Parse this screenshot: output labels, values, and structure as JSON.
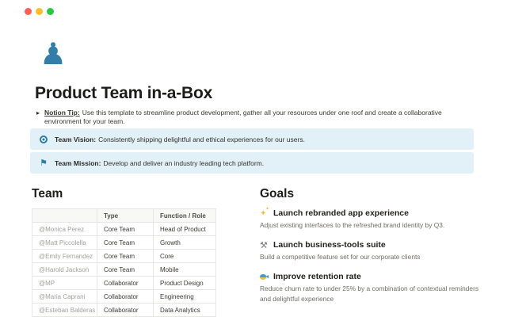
{
  "colors": {
    "accent_blue": "#337ea9",
    "callout_bg": "#e2f0f7",
    "traffic_red": "#ff5f57",
    "traffic_yellow": "#febc2e",
    "traffic_green": "#28c840"
  },
  "page": {
    "icon_glyph": "♟",
    "title": "Product Team in-a-Box",
    "tip": {
      "toggle_glyph": "▸",
      "label": "Notion Tip:",
      "text": "Use this template to streamline product development, gather all your resources under one roof and create a collaborative environment for your team."
    }
  },
  "callouts": [
    {
      "icon": "target-icon",
      "label": "Team Vision:",
      "text": "Consistently shipping delightful and ethical experiences for our users."
    },
    {
      "icon": "flag-icon",
      "glyph": "⚑",
      "label": "Team Mission:",
      "text": "Develop and deliver an industry leading tech platform."
    }
  ],
  "team": {
    "heading": "Team",
    "table": {
      "headers": [
        "",
        "Type",
        "Function / Role"
      ],
      "rows": [
        {
          "member": "@Monica Perez",
          "type": "Core Team",
          "role": "Head of Product"
        },
        {
          "member": "@Matt Piccolella",
          "type": "Core Team",
          "role": "Growth"
        },
        {
          "member": "@Emily Fernandez",
          "type": "Core Team",
          "role": "Core"
        },
        {
          "member": "@Harold Jackson",
          "type": "Core Team",
          "role": "Mobile"
        },
        {
          "member": "@MP",
          "type": "Collaborator",
          "role": "Product Design"
        },
        {
          "member": "@Maria Caprani",
          "type": "Collaborator",
          "role": "Engineering"
        },
        {
          "member": "@Esteban Balderas",
          "type": "Collaborator",
          "role": "Data Analytics"
        }
      ]
    }
  },
  "goals": {
    "heading": "Goals",
    "items": [
      {
        "icon": "sparkles-emoji",
        "sparkle_glyph": "✦",
        "title": "Launch rebranded app experience",
        "description": "Adjust existing interfaces to the refreshed brand identity by Q3."
      },
      {
        "icon": "hammer-and-wrench-emoji",
        "glyph": "⚒",
        "title": "Launch business-tools suite",
        "description": "Build a competitive feature set for our corporate clients"
      },
      {
        "icon": "tropical-fish-emoji",
        "title": "Improve retention rate",
        "description": "Reduce churn rate to under 25% by a combination of contextual reminders and delightful experience"
      }
    ]
  }
}
